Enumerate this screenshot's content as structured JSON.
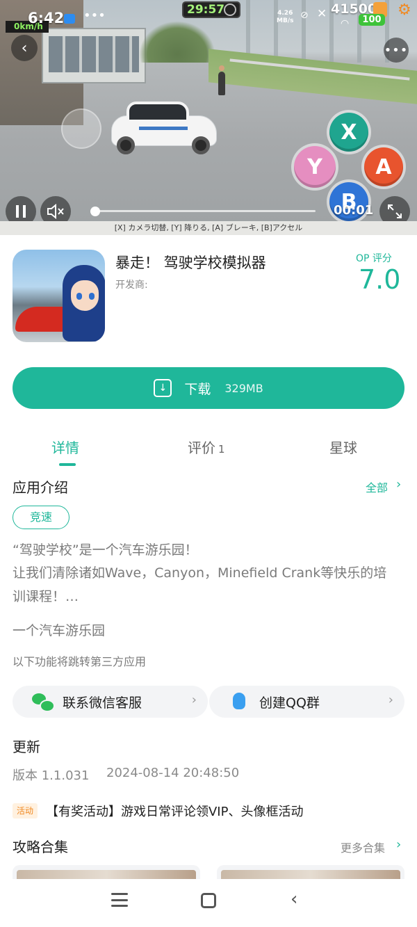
{
  "status_bar": {
    "time": "6:42",
    "speed": "0km/h",
    "timer": "29:57",
    "net_speed_value": "4.26",
    "net_speed_unit": "MB/s",
    "coins": "41500",
    "battery": "100"
  },
  "video": {
    "elapsed": "00:01",
    "progress": 0.01,
    "subtitle": "[X] カメラ切替, [Y] 降りる, [A] ブレーキ, [B]アクセル",
    "buttons": {
      "x": "X",
      "y": "Y",
      "a": "A",
      "b": "B"
    },
    "icons": {
      "back": "chevron-left-icon",
      "more": "more-dots-icon",
      "pause": "pause-icon",
      "mute": "speaker-muted-icon",
      "fullscreen": "fullscreen-icon"
    }
  },
  "app": {
    "title": "暴走！ 驾驶学校模拟器",
    "developer_label": "开发商:",
    "score_label": "OP 评分",
    "score": "7.0"
  },
  "download": {
    "label": "下载",
    "size": "329MB"
  },
  "tabs": [
    {
      "label": "详情",
      "active": true
    },
    {
      "label": "评价",
      "count": "1",
      "active": false
    },
    {
      "label": "星球",
      "active": false
    }
  ],
  "intro": {
    "title": "应用介绍",
    "see_all": "全部",
    "tag": "竞速",
    "lines": [
      "“驾驶学校”是一个汽车游乐园！",
      "让我们清除诸如Wave，Canyon，Minefield Crank等快乐的培",
      "训课程！…",
      "一个汽车游乐园"
    ],
    "third_party_note": "以下功能将跳转第三方应用"
  },
  "contacts": [
    {
      "label": "联系微信客服",
      "icon": "wechat-icon"
    },
    {
      "label": "创建QQ群",
      "icon": "qq-icon"
    }
  ],
  "update": {
    "title": "更新",
    "version": "版本 1.1.031",
    "date": "2024-08-14 20:48:50"
  },
  "activity": {
    "badge": "活动",
    "text": "【有奖活动】游戏日常评论领VIP、头像框活动"
  },
  "guides": {
    "title": "攻略合集",
    "more": "更多合集"
  },
  "colors": {
    "accent": "#1fb79a",
    "activity": "#f08a24"
  }
}
